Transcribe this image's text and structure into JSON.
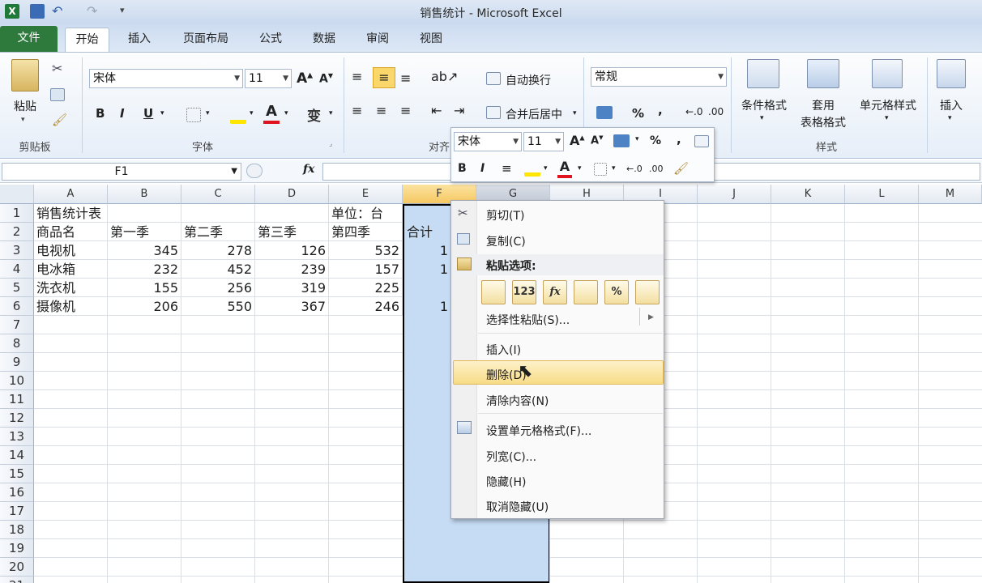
{
  "window": {
    "title": "销售统计  -  Microsoft Excel"
  },
  "tabs": {
    "file": "文件",
    "home": "开始",
    "insert": "插入",
    "layout": "页面布局",
    "formula": "公式",
    "data": "数据",
    "review": "审阅",
    "view": "视图"
  },
  "ribbon": {
    "paste": "粘贴",
    "clipboard": "剪贴板",
    "font_name": "宋体",
    "font_size": "11",
    "font_group": "字体",
    "wrap_text": "自动换行",
    "merge_center": "合并后居中",
    "align_group": "对齐",
    "number_format": "常规",
    "cond_format": "条件格式",
    "table_format_1": "套用",
    "table_format_2": "表格格式",
    "cell_style": "单元格样式",
    "insert": "插入",
    "style_group": "样式",
    "bold": "B",
    "italic": "I",
    "underline": "U",
    "percent": "%",
    "comma": ",",
    "phonetic": "变",
    "font_color": "A"
  },
  "formula_bar": {
    "name_box": "F1",
    "fx": "fx",
    "formula": ""
  },
  "columns": [
    "A",
    "B",
    "C",
    "D",
    "E",
    "F",
    "G",
    "H",
    "I",
    "J",
    "K",
    "L",
    "M"
  ],
  "rows": [
    "1",
    "2",
    "3",
    "4",
    "5",
    "6",
    "7",
    "8",
    "9",
    "10",
    "11",
    "12",
    "13",
    "14",
    "15",
    "16",
    "17",
    "18",
    "19",
    "20",
    "21"
  ],
  "sheet": {
    "r1": [
      "销售统计表",
      "",
      "",
      "",
      "单位：台",
      "",
      ""
    ],
    "r2": [
      "商品名",
      "第一季",
      "第二季",
      "第三季",
      "第四季",
      "合计"
    ],
    "r3": [
      "电视机",
      "345",
      "278",
      "126",
      "532",
      "1"
    ],
    "r4": [
      "电冰箱",
      "232",
      "452",
      "239",
      "157",
      "1"
    ],
    "r5": [
      "洗衣机",
      "155",
      "256",
      "319",
      "225",
      ""
    ],
    "r6": [
      "摄像机",
      "206",
      "550",
      "367",
      "246",
      "1"
    ]
  },
  "mini_toolbar": {
    "font": "宋体",
    "size": "11",
    "bold": "B",
    "italic": "I",
    "percent": "%",
    "comma": ","
  },
  "context_menu": {
    "cut": "剪切(T)",
    "copy": "复制(C)",
    "paste_options": "粘贴选项:",
    "paste_icons": [
      "",
      "123",
      "fx",
      "",
      "%",
      ""
    ],
    "paste_special": "选择性粘贴(S)...",
    "insert": "插入(I)",
    "delete": "删除(D)",
    "clear": "清除内容(N)",
    "format_cells": "设置单元格格式(F)...",
    "col_width": "列宽(C)...",
    "hide": "隐藏(H)",
    "unhide": "取消隐藏(U)"
  },
  "colors": {
    "accent": "#2d7a3c",
    "selection": "#c6dcf5",
    "hover": "#fbe9a8"
  }
}
